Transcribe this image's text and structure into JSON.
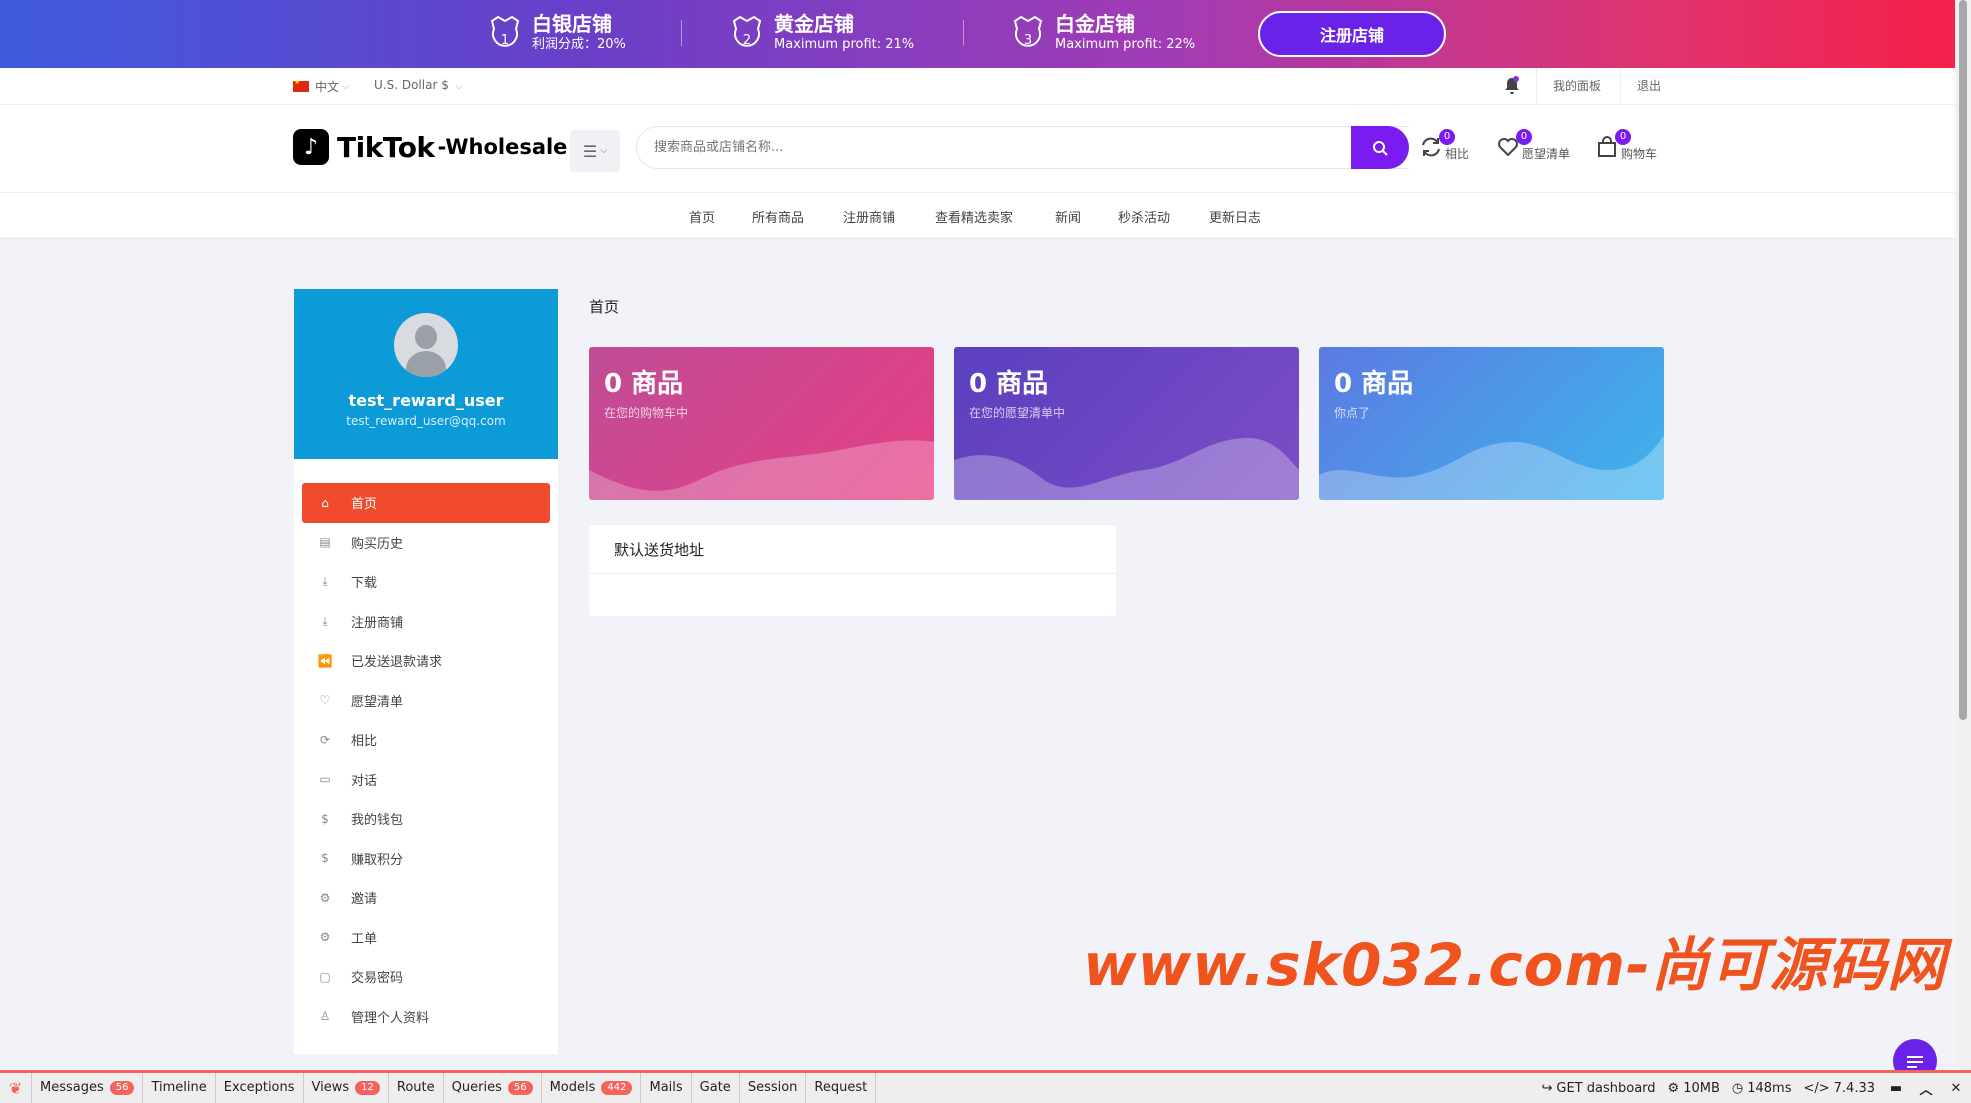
{
  "promo": {
    "tiers": [
      {
        "name": "白银店铺",
        "sub": "利润分成：20%",
        "num": "1"
      },
      {
        "name": "黄金店铺",
        "sub": "Maximum profit: 21%",
        "num": "2"
      },
      {
        "name": "白金店铺",
        "sub": "Maximum profit: 22%",
        "num": "3"
      }
    ],
    "register_label": "注册店铺"
  },
  "topbar": {
    "language": "中文",
    "currency": "U.S. Dollar $",
    "dashboard": "我的面板",
    "logout": "退出"
  },
  "header": {
    "logo_brand": "TikTok",
    "logo_suffix": "-Wholesale",
    "search_placeholder": "搜索商品或店铺名称...",
    "compare": {
      "label": "相比",
      "count": "0"
    },
    "wishlist": {
      "label": "愿望清单",
      "count": "0"
    },
    "cart": {
      "label": "购物车",
      "count": "0"
    }
  },
  "nav": [
    "首页",
    "所有商品",
    "注册商铺",
    "查看精选卖家",
    "新闻",
    "秒杀活动",
    "更新日志"
  ],
  "profile": {
    "username": "test_reward_user",
    "email": "test_reward_user@qq.com"
  },
  "sidebar": [
    {
      "label": "首页",
      "icon": "home-icon",
      "glyph": "⌂",
      "active": true
    },
    {
      "label": "购买历史",
      "icon": "document-icon",
      "glyph": "▤"
    },
    {
      "label": "下载",
      "icon": "download-icon",
      "glyph": "⤓"
    },
    {
      "label": "注册商铺",
      "icon": "download-icon",
      "glyph": "⤓"
    },
    {
      "label": "已发送退款请求",
      "icon": "rewind-icon",
      "glyph": "⏪"
    },
    {
      "label": "愿望清单",
      "icon": "heart-icon",
      "glyph": "♡"
    },
    {
      "label": "相比",
      "icon": "refresh-icon",
      "glyph": "⟳"
    },
    {
      "label": "对话",
      "icon": "message-icon",
      "glyph": "▭"
    },
    {
      "label": "我的钱包",
      "icon": "dollar-icon",
      "glyph": "$"
    },
    {
      "label": "赚取积分",
      "icon": "dollar-icon",
      "glyph": "$"
    },
    {
      "label": "邀请",
      "icon": "gear-icon",
      "glyph": "⚙"
    },
    {
      "label": "工单",
      "icon": "gear-icon",
      "glyph": "⚙"
    },
    {
      "label": "交易密码",
      "icon": "folder-icon",
      "glyph": "▢"
    },
    {
      "label": "管理个人资料",
      "icon": "user-icon",
      "glyph": "♙"
    }
  ],
  "main": {
    "breadcrumb": "首页",
    "cards": [
      {
        "title": "0 商品",
        "sub": "在您的购物车中"
      },
      {
        "title": "0 商品",
        "sub": "在您的愿望清单中"
      },
      {
        "title": "0 商品",
        "sub": "你点了"
      }
    ],
    "address_title": "默认送货地址"
  },
  "watermark": "www.sk032.com-尚可源码网",
  "debugbar": {
    "tabs": [
      {
        "label": "Messages",
        "count": "56"
      },
      {
        "label": "Timeline",
        "count": ""
      },
      {
        "label": "Exceptions",
        "count": ""
      },
      {
        "label": "Views",
        "count": "12"
      },
      {
        "label": "Route",
        "count": ""
      },
      {
        "label": "Queries",
        "count": "56"
      },
      {
        "label": "Models",
        "count": "442"
      },
      {
        "label": "Mails",
        "count": ""
      },
      {
        "label": "Gate",
        "count": ""
      },
      {
        "label": "Session",
        "count": ""
      },
      {
        "label": "Request",
        "count": ""
      }
    ],
    "request": "GET dashboard",
    "memory": "10MB",
    "time": "148ms",
    "php": "7.4.33"
  },
  "colors": {
    "accent": "#7a1bf0",
    "active_menu": "#f04b2c",
    "profile_bg": "#0d9bd8",
    "watermark": "#f0541e"
  }
}
